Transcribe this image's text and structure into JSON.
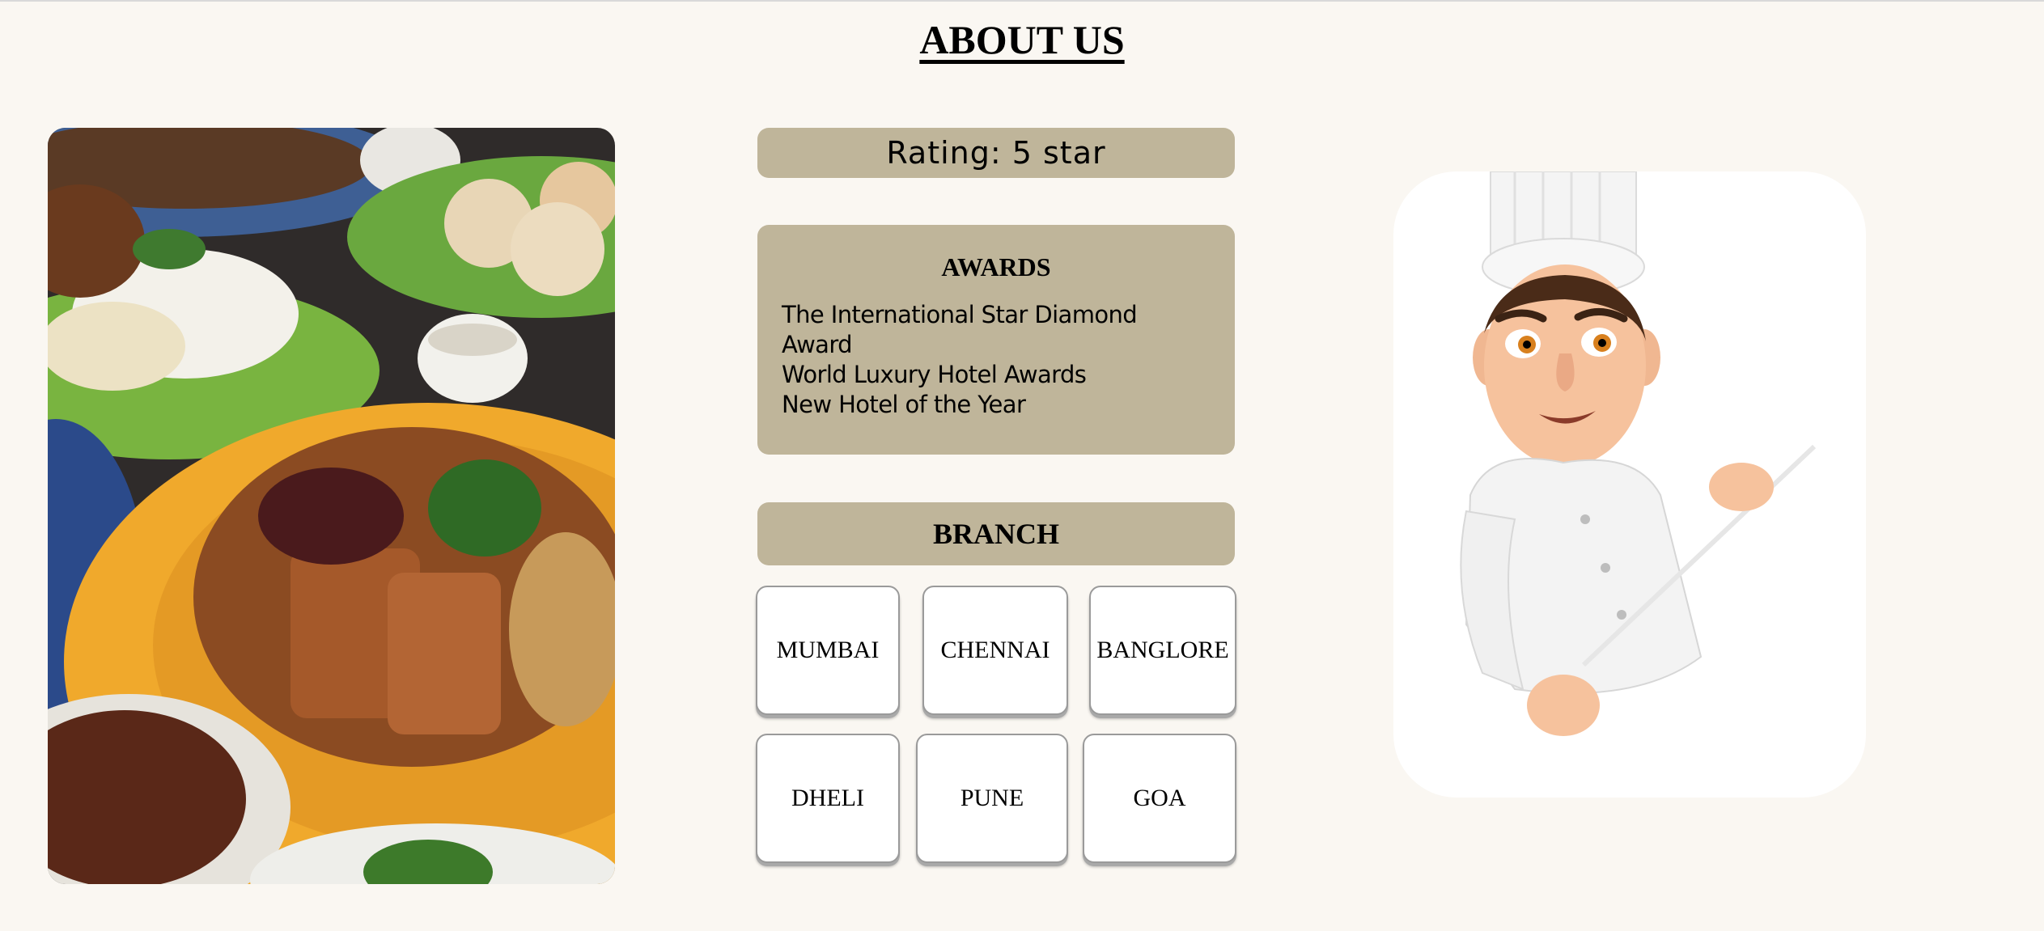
{
  "page": {
    "title": "ABOUT US"
  },
  "rating": {
    "text": "Rating: 5 star"
  },
  "awards": {
    "title": "AWARDS",
    "items": [
      "The International Star Diamond Award",
      "World Luxury Hotel Awards",
      "New Hotel of the Year"
    ]
  },
  "branch": {
    "title": "BRANCH",
    "buttons": [
      "MUMBAI",
      "CHENNAI",
      "BANGLORE",
      "DHELI",
      "PUNE",
      "GOA"
    ]
  },
  "images": {
    "food": "food-platter-photo",
    "chef": "chef-cartoon-illustration"
  },
  "colors": {
    "background": "#faf7f2",
    "panel": "#bfb59a",
    "card": "#ffffff"
  }
}
